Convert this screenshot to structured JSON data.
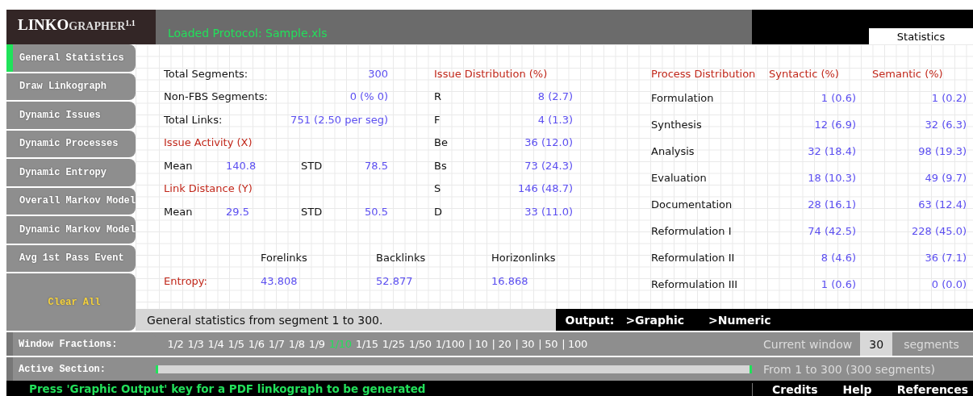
{
  "app": {
    "logo": "LINKO",
    "logo_small": "GRAPHER",
    "version": "1.1",
    "loaded_protocol": "Loaded Protocol:  Sample.xls"
  },
  "tabs": [
    {
      "label": "Statistics",
      "selected": true
    }
  ],
  "sidebar": {
    "items": [
      {
        "label": "General Statistics",
        "selected": true
      },
      {
        "label": "Draw Linkograph",
        "selected": false
      },
      {
        "label": "Dynamic Issues",
        "selected": false
      },
      {
        "label": "Dynamic Processes",
        "selected": false
      },
      {
        "label": "Dynamic Entropy",
        "selected": false
      },
      {
        "label": "Overall Markov Model",
        "selected": false
      },
      {
        "label": "Dynamic Markov Model",
        "selected": false
      },
      {
        "label": "Avg 1st Pass Event",
        "selected": false
      }
    ],
    "clear_button": "Clear All"
  },
  "summary": {
    "rows": [
      {
        "label": "Total Segments:",
        "value": "300"
      },
      {
        "label": "Non-FBS Segments:",
        "value": "0  (% 0)"
      },
      {
        "label": "Total Links:",
        "value": "751 (2.50 per seg)"
      }
    ],
    "issue_activity": {
      "heading": "Issue Activity (X)",
      "mean_label": "Mean",
      "mean": "140.8",
      "std_label": "STD",
      "std": "78.5"
    },
    "link_distance": {
      "heading": "Link Distance (Y)",
      "mean_label": "Mean",
      "mean": "29.5",
      "std_label": "STD",
      "std": "50.5"
    }
  },
  "issue_distribution": {
    "heading": "Issue Distribution (%)",
    "rows": [
      {
        "label": "R",
        "value": "8  (2.7)"
      },
      {
        "label": "F",
        "value": "4  (1.3)"
      },
      {
        "label": "Be",
        "value": "36  (12.0)"
      },
      {
        "label": "Bs",
        "value": "73  (24.3)"
      },
      {
        "label": "S",
        "value": "146  (48.7)"
      },
      {
        "label": "D",
        "value": "33  (11.0)"
      }
    ]
  },
  "process_distribution": {
    "heading": "Process Distribution",
    "syntactic_heading": "Syntactic (%)",
    "semantic_heading": "Semantic (%)",
    "rows": [
      {
        "label": "Formulation",
        "syntactic": "1  (0.6)",
        "semantic": "1  (0.2)"
      },
      {
        "label": "Synthesis",
        "syntactic": "12  (6.9)",
        "semantic": "32  (6.3)"
      },
      {
        "label": "Analysis",
        "syntactic": "32  (18.4)",
        "semantic": "98  (19.3)"
      },
      {
        "label": "Evaluation",
        "syntactic": "18  (10.3)",
        "semantic": "49  (9.7)"
      },
      {
        "label": "Documentation",
        "syntactic": "28  (16.1)",
        "semantic": "63  (12.4)"
      },
      {
        "label": "Reformulation I",
        "syntactic": "74  (42.5)",
        "semantic": "228  (45.0)"
      },
      {
        "label": "Reformulation II",
        "syntactic": "8  (4.6)",
        "semantic": "36  (7.1)"
      },
      {
        "label": "Reformulation III",
        "syntactic": "1  (0.6)",
        "semantic": "0  (0.0)"
      }
    ]
  },
  "entropy": {
    "label": "Entropy:",
    "columns": [
      {
        "heading": "Forelinks",
        "value": "43.808"
      },
      {
        "heading": "Backlinks",
        "value": "52.877"
      },
      {
        "heading": "Horizonlinks",
        "value": "16.868"
      }
    ]
  },
  "status": "General statistics from segment 1 to 300.",
  "output": {
    "label": "Output:",
    "options": [
      ">Graphic",
      ">Numeric"
    ]
  },
  "window_fractions": {
    "label": "Window Fractions:",
    "items": [
      {
        "label": "1/2",
        "selected": false
      },
      {
        "label": "1/3",
        "selected": false
      },
      {
        "label": "1/4",
        "selected": false
      },
      {
        "label": "1/5",
        "selected": false
      },
      {
        "label": "1/6",
        "selected": false
      },
      {
        "label": "1/7",
        "selected": false
      },
      {
        "label": "1/8",
        "selected": false
      },
      {
        "label": "1/9",
        "selected": false
      },
      {
        "label": "1/10",
        "selected": true
      },
      {
        "label": "1/15",
        "selected": false
      },
      {
        "label": "1/25",
        "selected": false
      },
      {
        "label": "1/50",
        "selected": false
      },
      {
        "label": "1/100",
        "selected": false
      },
      {
        "label": "| 10",
        "selected": false
      },
      {
        "label": "| 20",
        "selected": false
      },
      {
        "label": "| 30",
        "selected": false
      },
      {
        "label": "| 50",
        "selected": false
      },
      {
        "label": "| 100",
        "selected": false
      }
    ],
    "current_window_label": "Current window",
    "current_window": "30",
    "unit": "segments"
  },
  "active_section": {
    "label": "Active Section:",
    "level": 1,
    "range": "From 1 to 300 (300 segments)"
  },
  "footer": {
    "message": "Press 'Graphic Output' key for a PDF linkograph to be generated",
    "links": [
      "Credits",
      "Help",
      "References"
    ]
  }
}
